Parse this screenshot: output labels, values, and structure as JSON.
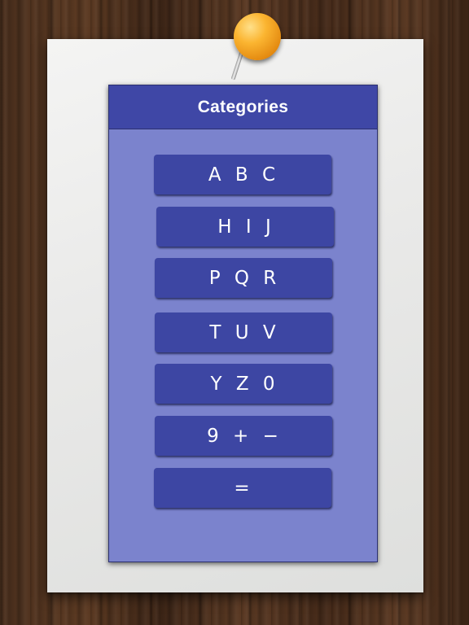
{
  "header": {
    "title": "Categories"
  },
  "categories": [
    {
      "label": "A B C"
    },
    {
      "label": "H I J"
    },
    {
      "label": "P Q R"
    },
    {
      "label": "T U V"
    },
    {
      "label": "Y Z 0"
    },
    {
      "label": "9 + −"
    },
    {
      "label": "="
    }
  ],
  "colors": {
    "header_bg": "#3f47a6",
    "panel_bg": "#7b83cd",
    "button_bg": "#3d46a3",
    "text": "#ffffff",
    "pin": "#fbb531"
  }
}
